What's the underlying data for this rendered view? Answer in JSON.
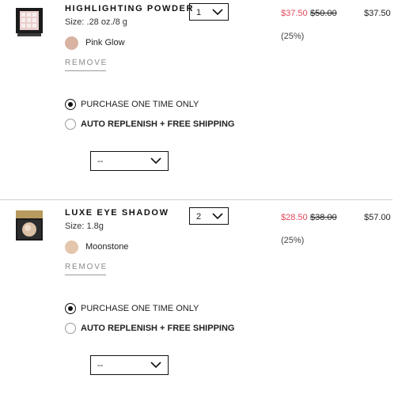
{
  "cart_items": [
    {
      "name": "HIGHLIGHTING POWDER",
      "size": "Size: .28 oz./8 g",
      "shade": "Pink Glow",
      "shade_color": "#d8b3a2",
      "remove_label": "REMOVE",
      "quantity": "1",
      "sale_price": "$37.50",
      "original_price": "$50.00",
      "discount": "(25%)",
      "line_total": "$37.50",
      "purchase_options": [
        {
          "label": "PURCHASE ONE TIME ONLY",
          "selected": true
        },
        {
          "label": "AUTO REPLENISH + FREE SHIPPING",
          "selected": false
        }
      ],
      "frequency_value": "--",
      "thumbnail": "highlighting-powder-compact"
    },
    {
      "name": "LUXE EYE SHADOW",
      "size": "Size: 1.8g",
      "shade": "Moonstone",
      "shade_color": "#e3c6ac",
      "remove_label": "REMOVE",
      "quantity": "2",
      "sale_price": "$28.50",
      "original_price": "$38.00",
      "discount": "(25%)",
      "line_total": "$57.00",
      "purchase_options": [
        {
          "label": "PURCHASE ONE TIME ONLY",
          "selected": true
        },
        {
          "label": "AUTO REPLENISH + FREE SHIPPING",
          "selected": false
        }
      ],
      "frequency_value": "--",
      "thumbnail": "luxe-eye-shadow-compact"
    }
  ],
  "colors": {
    "sale_price": "#e0485a",
    "text": "#222222",
    "muted": "#8a8a8a",
    "divider": "#cfcfcf"
  }
}
